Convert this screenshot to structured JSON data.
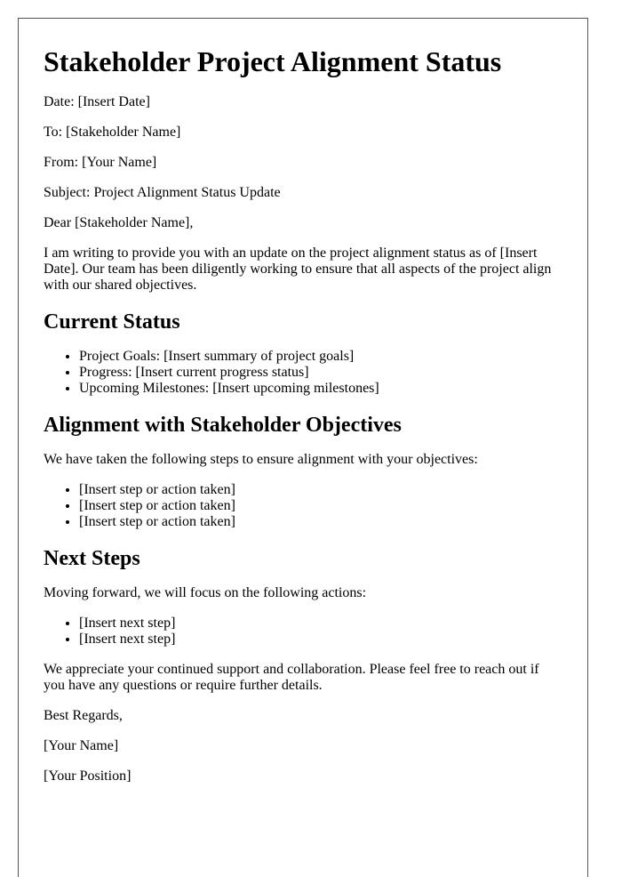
{
  "title": "Stakeholder Project Alignment Status",
  "header_fields": {
    "date": "Date: [Insert Date]",
    "to": "To: [Stakeholder Name]",
    "from": "From: [Your Name]",
    "subject": "Subject: Project Alignment Status Update"
  },
  "salutation": "Dear [Stakeholder Name],",
  "intro": "I am writing to provide you with an update on the project alignment status as of [Insert Date]. Our team has been diligently working to ensure that all aspects of the project align with our shared objectives.",
  "sections": {
    "current_status": {
      "heading": "Current Status",
      "items": [
        "Project Goals: [Insert summary of project goals]",
        "Progress: [Insert current progress status]",
        "Upcoming Milestones: [Insert upcoming milestones]"
      ]
    },
    "alignment": {
      "heading": "Alignment with Stakeholder Objectives",
      "intro": "We have taken the following steps to ensure alignment with your objectives:",
      "items": [
        "[Insert step or action taken]",
        "[Insert step or action taken]",
        "[Insert step or action taken]"
      ]
    },
    "next_steps": {
      "heading": "Next Steps",
      "intro": "Moving forward, we will focus on the following actions:",
      "items": [
        "[Insert next step]",
        "[Insert next step]"
      ]
    }
  },
  "closing_paragraph": "We appreciate your continued support and collaboration. Please feel free to reach out if you have any questions or require further details.",
  "signoff": "Best Regards,",
  "signature_name": "[Your Name]",
  "signature_position": "[Your Position]"
}
